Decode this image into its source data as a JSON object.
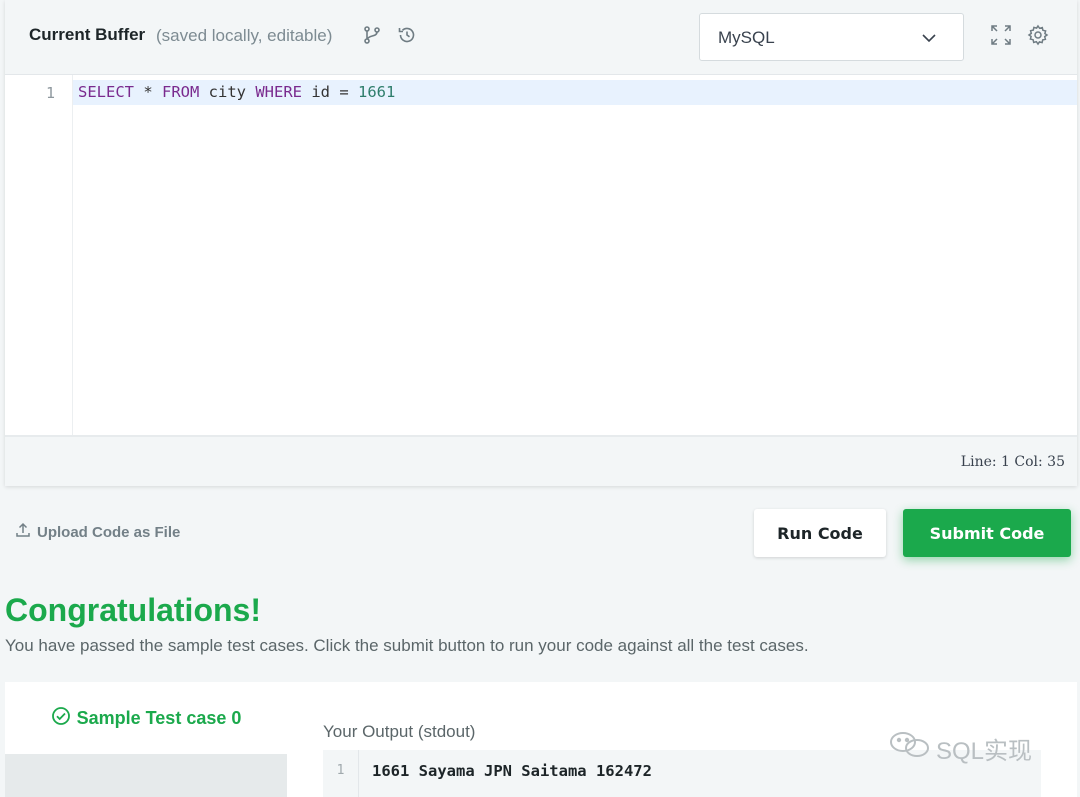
{
  "header": {
    "title": "Current Buffer",
    "subtitle": "(saved locally, editable)",
    "language": "MySQL"
  },
  "editor": {
    "line_numbers": [
      "1"
    ],
    "code": {
      "kw1": "SELECT",
      "t1": " * ",
      "kw2": "FROM",
      "t2": " city ",
      "kw3": "WHERE",
      "t3": " id = ",
      "num": "1661"
    },
    "status": "Line: 1 Col: 35"
  },
  "actions": {
    "upload_label": "Upload Code as File",
    "run_label": "Run Code",
    "submit_label": "Submit Code"
  },
  "result": {
    "heading": "Congratulations!",
    "message": "You have passed the sample test cases. Click the submit button to run your code against all the test cases.",
    "test_case_label": "Sample Test case 0",
    "output_label": "Your Output (stdout)",
    "output_line_number": "1",
    "output_text": "1661 Sayama JPN Saitama 162472"
  },
  "watermark": "SQL实现",
  "colors": {
    "accent_green": "#1ba94c",
    "keyword": "#7a2a8e",
    "number": "#2e7d6b"
  }
}
